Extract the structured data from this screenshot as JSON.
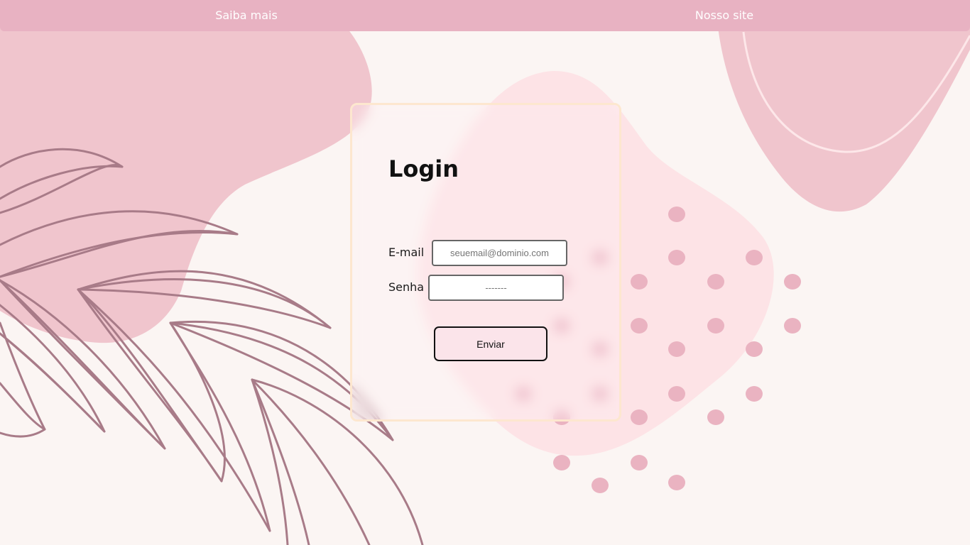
{
  "nav": {
    "links": [
      {
        "label": "Saiba mais"
      },
      {
        "label": "Nosso site"
      }
    ]
  },
  "login": {
    "title": "Login",
    "email": {
      "label": "E-mail",
      "placeholder": "seuemail@dominio.com",
      "value": ""
    },
    "password": {
      "label": "Senha",
      "placeholder": "-------",
      "value": ""
    },
    "submit_label": "Enviar"
  },
  "colors": {
    "background": "#fbf5f3",
    "nav_bar": "#e8b2c2",
    "blob_pink": "#f0c5cd",
    "blob_light": "#fde3e6",
    "dots": "#eab3c1",
    "leaf_stroke": "#a87b88",
    "card_border": "#fde7cf",
    "button_fill": "#fbe4ea"
  },
  "decor": {
    "illustration": "abstract-blobs-and-palm-leaves"
  }
}
